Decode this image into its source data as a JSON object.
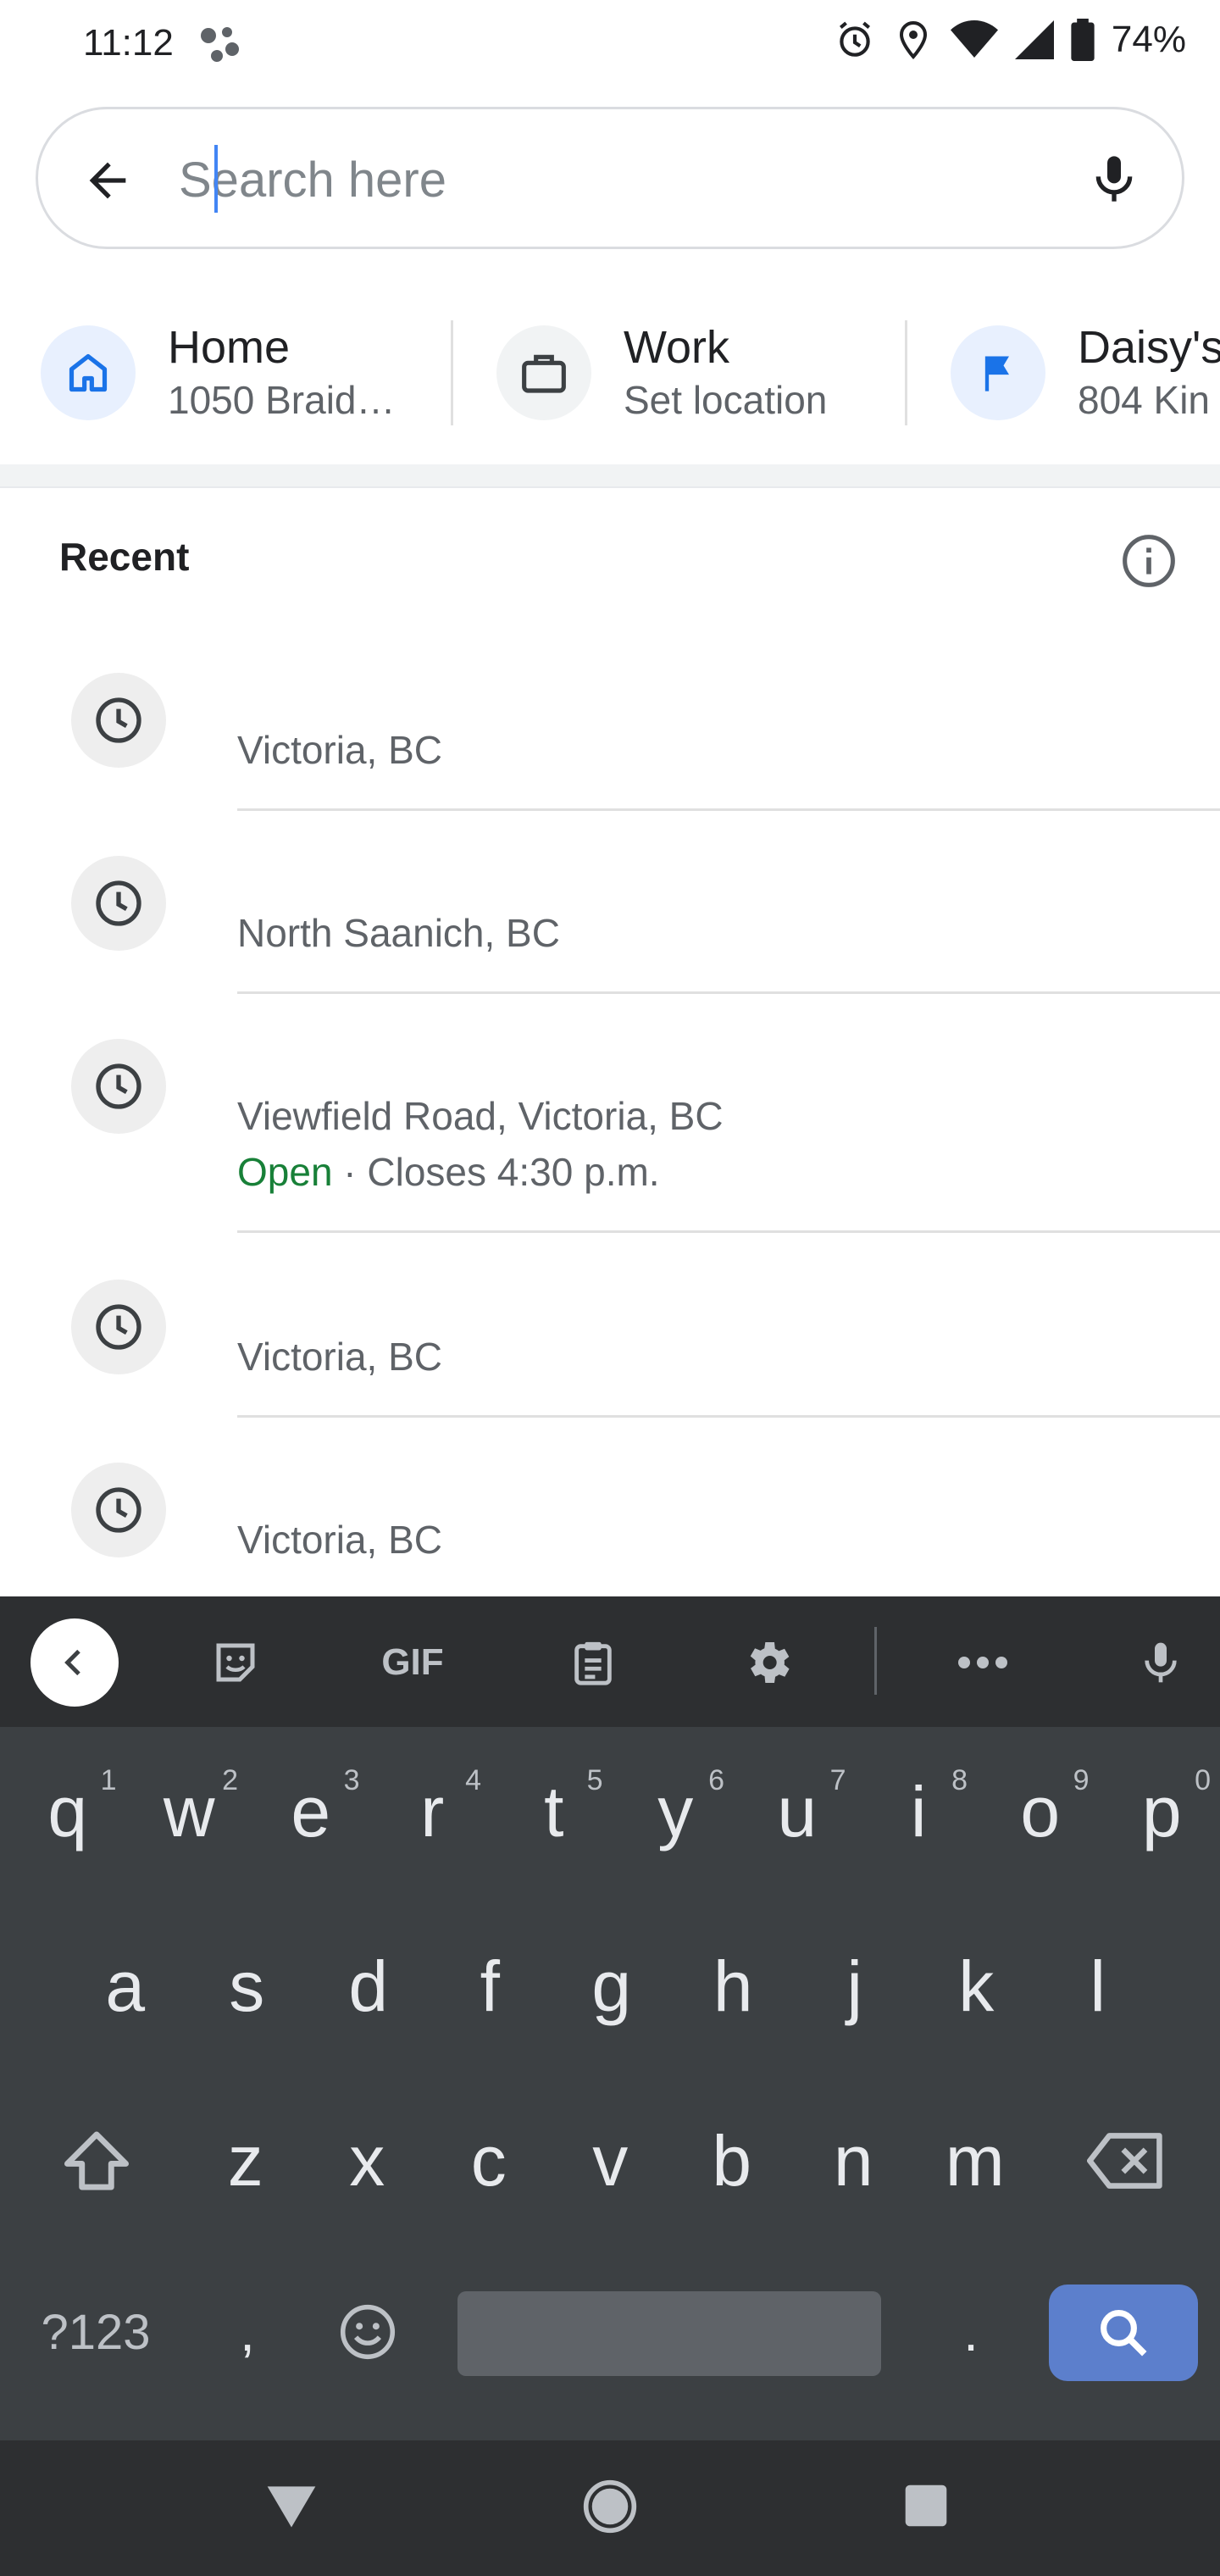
{
  "status_bar": {
    "time": "11:12",
    "battery": "74%",
    "icons": [
      "assistant-icon",
      "alarm-icon",
      "location-icon",
      "wifi-icon",
      "signal-icon",
      "battery-icon"
    ]
  },
  "search": {
    "placeholder": "Search here",
    "value": ""
  },
  "shortcuts": [
    {
      "title": "Home",
      "subtitle": "1050 Braid…",
      "icon": "home-icon",
      "color": "#1a73e8"
    },
    {
      "title": "Work",
      "subtitle": "Set location",
      "icon": "briefcase-icon",
      "color": "#3c4043"
    },
    {
      "title": "Daisy's",
      "subtitle": "804 Kin",
      "icon": "flag-icon",
      "color": "#1a73e8"
    }
  ],
  "recent": {
    "heading": "Recent",
    "items": [
      {
        "address": "Victoria, BC"
      },
      {
        "address": "North Saanich, BC"
      },
      {
        "address": "Viewfield Road, Victoria, BC",
        "open": "Open",
        "hours": " · Closes 4:30 p.m."
      },
      {
        "address": "Victoria, BC"
      },
      {
        "address": "Victoria, BC"
      }
    ]
  },
  "keyboard": {
    "toolbar": [
      "back-arrow-icon",
      "sticker-icon",
      "gif-icon",
      "clipboard-icon",
      "settings-icon",
      "more-icon",
      "mic-icon"
    ],
    "gif_label": "GIF",
    "row1": [
      {
        "k": "q",
        "h": "1"
      },
      {
        "k": "w",
        "h": "2"
      },
      {
        "k": "e",
        "h": "3"
      },
      {
        "k": "r",
        "h": "4"
      },
      {
        "k": "t",
        "h": "5"
      },
      {
        "k": "y",
        "h": "6"
      },
      {
        "k": "u",
        "h": "7"
      },
      {
        "k": "i",
        "h": "8"
      },
      {
        "k": "o",
        "h": "9"
      },
      {
        "k": "p",
        "h": "0"
      }
    ],
    "row2": [
      "a",
      "s",
      "d",
      "f",
      "g",
      "h",
      "j",
      "k",
      "l"
    ],
    "row3": [
      "z",
      "x",
      "c",
      "v",
      "b",
      "n",
      "m"
    ],
    "symbols_label": "?123",
    "comma": ",",
    "period": "."
  },
  "colors": {
    "accent": "#1a73e8",
    "open_green": "#188038",
    "keyboard_bg": "#3c4043",
    "search_key": "#5c7fcc"
  }
}
